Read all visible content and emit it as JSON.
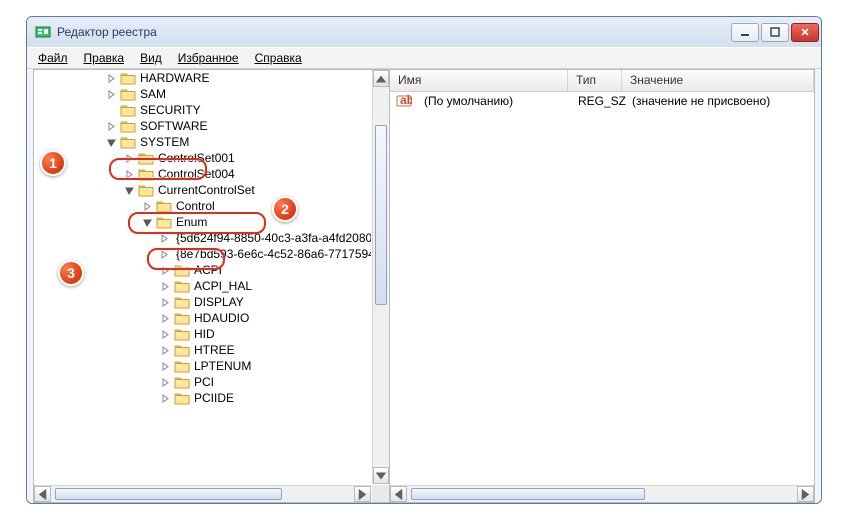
{
  "window": {
    "title": "Редактор реестра"
  },
  "menu": {
    "file": "Файл",
    "edit": "Правка",
    "view": "Вид",
    "favorites": "Избранное",
    "help": "Справка"
  },
  "columns": {
    "name": "Имя",
    "type": "Тип",
    "value": "Значение"
  },
  "list": {
    "row0": {
      "name": "(По умолчанию)",
      "type": "REG_SZ",
      "value": "(значение не присвоено)"
    }
  },
  "tree": [
    {
      "indent": 3,
      "expand": "closed",
      "label": "HARDWARE"
    },
    {
      "indent": 3,
      "expand": "closed",
      "label": "SAM"
    },
    {
      "indent": 3,
      "expand": "none",
      "label": "SECURITY"
    },
    {
      "indent": 3,
      "expand": "closed",
      "label": "SOFTWARE"
    },
    {
      "indent": 3,
      "expand": "open",
      "label": "SYSTEM"
    },
    {
      "indent": 4,
      "expand": "closed",
      "label": "ControlSet001"
    },
    {
      "indent": 4,
      "expand": "closed",
      "label": "ControlSet004"
    },
    {
      "indent": 4,
      "expand": "open",
      "label": "CurrentControlSet"
    },
    {
      "indent": 5,
      "expand": "closed",
      "label": "Control"
    },
    {
      "indent": 5,
      "expand": "open",
      "label": "Enum"
    },
    {
      "indent": 6,
      "expand": "closed",
      "label": "{5d624f94-8850-40c3-a3fa-a4fd2080"
    },
    {
      "indent": 6,
      "expand": "closed",
      "label": "{8e7bd593-6e6c-4c52-86a6-7717594"
    },
    {
      "indent": 6,
      "expand": "closed",
      "label": "ACPI"
    },
    {
      "indent": 6,
      "expand": "closed",
      "label": "ACPI_HAL"
    },
    {
      "indent": 6,
      "expand": "closed",
      "label": "DISPLAY"
    },
    {
      "indent": 6,
      "expand": "closed",
      "label": "HDAUDIO"
    },
    {
      "indent": 6,
      "expand": "closed",
      "label": "HID"
    },
    {
      "indent": 6,
      "expand": "closed",
      "label": "HTREE"
    },
    {
      "indent": 6,
      "expand": "closed",
      "label": "LPTENUM"
    },
    {
      "indent": 6,
      "expand": "closed",
      "label": "PCI"
    },
    {
      "indent": 6,
      "expand": "closed",
      "label": "PCIIDE"
    }
  ],
  "callouts": {
    "c1": "1",
    "c2": "2",
    "c3": "3"
  }
}
